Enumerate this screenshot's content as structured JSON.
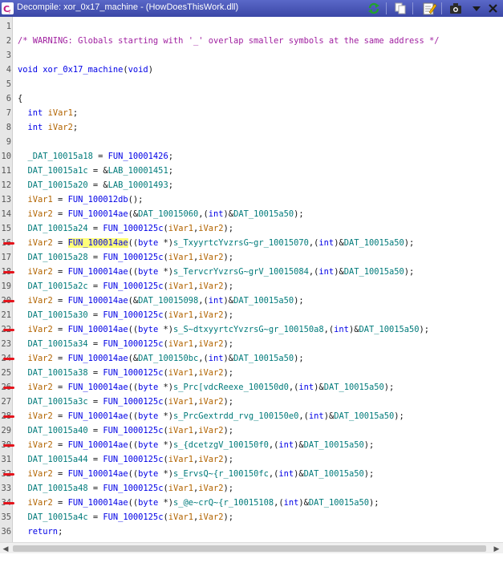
{
  "window": {
    "title": "Decompile: xor_0x17_machine - (HowDoesThisWork.dll)",
    "toolbar": [
      "refresh-icon",
      "copy-icon",
      "edit-icon",
      "snapshot-icon",
      "menu-dropdown-icon",
      "close-icon"
    ]
  },
  "colors": {
    "titlebar": "#4652b6",
    "annotation": "#e4141c",
    "highlight": "#ffff7a"
  },
  "lines": [
    {
      "n": "1",
      "tokens": []
    },
    {
      "n": "2",
      "tokens": [
        {
          "t": "/* WARNING: Globals starting with '_' overlap smaller symbols at the same address */",
          "c": "comment"
        }
      ]
    },
    {
      "n": "3",
      "tokens": []
    },
    {
      "n": "4",
      "tokens": [
        {
          "t": "void",
          "c": "type"
        },
        {
          "t": " "
        },
        {
          "t": "xor_0x17_machine",
          "c": "func"
        },
        {
          "t": "("
        },
        {
          "t": "void",
          "c": "type"
        },
        {
          "t": ")"
        }
      ]
    },
    {
      "n": "5",
      "tokens": []
    },
    {
      "n": "6",
      "tokens": [
        {
          "t": "{"
        }
      ]
    },
    {
      "n": "7",
      "tokens": [
        {
          "t": "  "
        },
        {
          "t": "int",
          "c": "type"
        },
        {
          "t": " "
        },
        {
          "t": "iVar1",
          "c": "local"
        },
        {
          "t": ";"
        }
      ]
    },
    {
      "n": "8",
      "tokens": [
        {
          "t": "  "
        },
        {
          "t": "int",
          "c": "type"
        },
        {
          "t": " "
        },
        {
          "t": "iVar2",
          "c": "local"
        },
        {
          "t": ";"
        }
      ]
    },
    {
      "n": "9",
      "tokens": []
    },
    {
      "n": "10",
      "tokens": [
        {
          "t": "  "
        },
        {
          "t": "_DAT_10015a18",
          "c": "global"
        },
        {
          "t": " = "
        },
        {
          "t": "FUN_10001426",
          "c": "func"
        },
        {
          "t": ";"
        }
      ]
    },
    {
      "n": "11",
      "tokens": [
        {
          "t": "  "
        },
        {
          "t": "DAT_10015a1c",
          "c": "global"
        },
        {
          "t": " = &"
        },
        {
          "t": "LAB_10001451",
          "c": "global"
        },
        {
          "t": ";"
        }
      ]
    },
    {
      "n": "12",
      "tokens": [
        {
          "t": "  "
        },
        {
          "t": "DAT_10015a20",
          "c": "global"
        },
        {
          "t": " = &"
        },
        {
          "t": "LAB_10001493",
          "c": "global"
        },
        {
          "t": ";"
        }
      ]
    },
    {
      "n": "13",
      "tokens": [
        {
          "t": "  "
        },
        {
          "t": "iVar1",
          "c": "local"
        },
        {
          "t": " = "
        },
        {
          "t": "FUN_100012db",
          "c": "func"
        },
        {
          "t": "();"
        }
      ]
    },
    {
      "n": "14",
      "tokens": [
        {
          "t": "  "
        },
        {
          "t": "iVar2",
          "c": "local"
        },
        {
          "t": " = "
        },
        {
          "t": "FUN_100014ae",
          "c": "func"
        },
        {
          "t": "(&"
        },
        {
          "t": "DAT_10015060",
          "c": "global"
        },
        {
          "t": ",("
        },
        {
          "t": "int",
          "c": "type"
        },
        {
          "t": ")&"
        },
        {
          "t": "DAT_10015a50",
          "c": "global"
        },
        {
          "t": ");"
        }
      ]
    },
    {
      "n": "15",
      "tokens": [
        {
          "t": "  "
        },
        {
          "t": "DAT_10015a24",
          "c": "global"
        },
        {
          "t": " = "
        },
        {
          "t": "FUN_1000125c",
          "c": "func"
        },
        {
          "t": "("
        },
        {
          "t": "iVar1",
          "c": "local"
        },
        {
          "t": ","
        },
        {
          "t": "iVar2",
          "c": "local"
        },
        {
          "t": ");"
        }
      ]
    },
    {
      "n": "16",
      "mark": true,
      "tokens": [
        {
          "t": "  "
        },
        {
          "t": "iVar2",
          "c": "local"
        },
        {
          "t": " = "
        },
        {
          "t": "FUN_100014ae",
          "c": "func hl"
        },
        {
          "t": "(("
        },
        {
          "t": "byte",
          "c": "type"
        },
        {
          "t": " *)"
        },
        {
          "t": "s_TxyyrtcYvzrsG~gr_10015070",
          "c": "str"
        },
        {
          "t": ",("
        },
        {
          "t": "int",
          "c": "type"
        },
        {
          "t": ")&"
        },
        {
          "t": "DAT_10015a50",
          "c": "global"
        },
        {
          "t": ");"
        }
      ]
    },
    {
      "n": "17",
      "tokens": [
        {
          "t": "  "
        },
        {
          "t": "DAT_10015a28",
          "c": "global"
        },
        {
          "t": " = "
        },
        {
          "t": "FUN_1000125c",
          "c": "func"
        },
        {
          "t": "("
        },
        {
          "t": "iVar1",
          "c": "local"
        },
        {
          "t": ","
        },
        {
          "t": "iVar2",
          "c": "local"
        },
        {
          "t": ");"
        }
      ]
    },
    {
      "n": "18",
      "mark": true,
      "tokens": [
        {
          "t": "  "
        },
        {
          "t": "iVar2",
          "c": "local"
        },
        {
          "t": " = "
        },
        {
          "t": "FUN_100014ae",
          "c": "func"
        },
        {
          "t": "(("
        },
        {
          "t": "byte",
          "c": "type"
        },
        {
          "t": " *)"
        },
        {
          "t": "s_TervcrYvzrsG~grV_10015084",
          "c": "str"
        },
        {
          "t": ",("
        },
        {
          "t": "int",
          "c": "type"
        },
        {
          "t": ")&"
        },
        {
          "t": "DAT_10015a50",
          "c": "global"
        },
        {
          "t": ");"
        }
      ]
    },
    {
      "n": "19",
      "tokens": [
        {
          "t": "  "
        },
        {
          "t": "DAT_10015a2c",
          "c": "global"
        },
        {
          "t": " = "
        },
        {
          "t": "FUN_1000125c",
          "c": "func"
        },
        {
          "t": "("
        },
        {
          "t": "iVar1",
          "c": "local"
        },
        {
          "t": ","
        },
        {
          "t": "iVar2",
          "c": "local"
        },
        {
          "t": ");"
        }
      ]
    },
    {
      "n": "20",
      "mark": true,
      "tokens": [
        {
          "t": "  "
        },
        {
          "t": "iVar2",
          "c": "local"
        },
        {
          "t": " = "
        },
        {
          "t": "FUN_100014ae",
          "c": "func"
        },
        {
          "t": "(&"
        },
        {
          "t": "DAT_10015098",
          "c": "global"
        },
        {
          "t": ",("
        },
        {
          "t": "int",
          "c": "type"
        },
        {
          "t": ")&"
        },
        {
          "t": "DAT_10015a50",
          "c": "global"
        },
        {
          "t": ");"
        }
      ]
    },
    {
      "n": "21",
      "tokens": [
        {
          "t": "  "
        },
        {
          "t": "DAT_10015a30",
          "c": "global"
        },
        {
          "t": " = "
        },
        {
          "t": "FUN_1000125c",
          "c": "func"
        },
        {
          "t": "("
        },
        {
          "t": "iVar1",
          "c": "local"
        },
        {
          "t": ","
        },
        {
          "t": "iVar2",
          "c": "local"
        },
        {
          "t": ");"
        }
      ]
    },
    {
      "n": "22",
      "mark": true,
      "tokens": [
        {
          "t": "  "
        },
        {
          "t": "iVar2",
          "c": "local"
        },
        {
          "t": " = "
        },
        {
          "t": "FUN_100014ae",
          "c": "func"
        },
        {
          "t": "(("
        },
        {
          "t": "byte",
          "c": "type"
        },
        {
          "t": " *)"
        },
        {
          "t": "s_S~dtxyyrtcYvzrsG~gr_100150a8",
          "c": "str"
        },
        {
          "t": ",("
        },
        {
          "t": "int",
          "c": "type"
        },
        {
          "t": ")&"
        },
        {
          "t": "DAT_10015a50",
          "c": "global"
        },
        {
          "t": ");"
        }
      ]
    },
    {
      "n": "23",
      "tokens": [
        {
          "t": "  "
        },
        {
          "t": "DAT_10015a34",
          "c": "global"
        },
        {
          "t": " = "
        },
        {
          "t": "FUN_1000125c",
          "c": "func"
        },
        {
          "t": "("
        },
        {
          "t": "iVar1",
          "c": "local"
        },
        {
          "t": ","
        },
        {
          "t": "iVar2",
          "c": "local"
        },
        {
          "t": ");"
        }
      ]
    },
    {
      "n": "24",
      "mark": true,
      "tokens": [
        {
          "t": "  "
        },
        {
          "t": "iVar2",
          "c": "local"
        },
        {
          "t": " = "
        },
        {
          "t": "FUN_100014ae",
          "c": "func"
        },
        {
          "t": "(&"
        },
        {
          "t": "DAT_100150bc",
          "c": "global"
        },
        {
          "t": ",("
        },
        {
          "t": "int",
          "c": "type"
        },
        {
          "t": ")&"
        },
        {
          "t": "DAT_10015a50",
          "c": "global"
        },
        {
          "t": ");"
        }
      ]
    },
    {
      "n": "25",
      "tokens": [
        {
          "t": "  "
        },
        {
          "t": "DAT_10015a38",
          "c": "global"
        },
        {
          "t": " = "
        },
        {
          "t": "FUN_1000125c",
          "c": "func"
        },
        {
          "t": "("
        },
        {
          "t": "iVar1",
          "c": "local"
        },
        {
          "t": ","
        },
        {
          "t": "iVar2",
          "c": "local"
        },
        {
          "t": ");"
        }
      ]
    },
    {
      "n": "26",
      "mark": true,
      "tokens": [
        {
          "t": "  "
        },
        {
          "t": "iVar2",
          "c": "local"
        },
        {
          "t": " = "
        },
        {
          "t": "FUN_100014ae",
          "c": "func"
        },
        {
          "t": "(("
        },
        {
          "t": "byte",
          "c": "type"
        },
        {
          "t": " *)"
        },
        {
          "t": "s_Prc[vdcReexe_100150d0",
          "c": "str"
        },
        {
          "t": ",("
        },
        {
          "t": "int",
          "c": "type"
        },
        {
          "t": ")&"
        },
        {
          "t": "DAT_10015a50",
          "c": "global"
        },
        {
          "t": ");"
        }
      ]
    },
    {
      "n": "27",
      "tokens": [
        {
          "t": "  "
        },
        {
          "t": "DAT_10015a3c",
          "c": "global"
        },
        {
          "t": " = "
        },
        {
          "t": "FUN_1000125c",
          "c": "func"
        },
        {
          "t": "("
        },
        {
          "t": "iVar1",
          "c": "local"
        },
        {
          "t": ","
        },
        {
          "t": "iVar2",
          "c": "local"
        },
        {
          "t": ");"
        }
      ]
    },
    {
      "n": "28",
      "mark": true,
      "tokens": [
        {
          "t": "  "
        },
        {
          "t": "iVar2",
          "c": "local"
        },
        {
          "t": " = "
        },
        {
          "t": "FUN_100014ae",
          "c": "func"
        },
        {
          "t": "(("
        },
        {
          "t": "byte",
          "c": "type"
        },
        {
          "t": " *)"
        },
        {
          "t": "s_PrcGextrdd_rvg_100150e0",
          "c": "str"
        },
        {
          "t": ",("
        },
        {
          "t": "int",
          "c": "type"
        },
        {
          "t": ")&"
        },
        {
          "t": "DAT_10015a50",
          "c": "global"
        },
        {
          "t": ");"
        }
      ]
    },
    {
      "n": "29",
      "tokens": [
        {
          "t": "  "
        },
        {
          "t": "DAT_10015a40",
          "c": "global"
        },
        {
          "t": " = "
        },
        {
          "t": "FUN_1000125c",
          "c": "func"
        },
        {
          "t": "("
        },
        {
          "t": "iVar1",
          "c": "local"
        },
        {
          "t": ","
        },
        {
          "t": "iVar2",
          "c": "local"
        },
        {
          "t": ");"
        }
      ]
    },
    {
      "n": "30",
      "mark": true,
      "tokens": [
        {
          "t": "  "
        },
        {
          "t": "iVar2",
          "c": "local"
        },
        {
          "t": " = "
        },
        {
          "t": "FUN_100014ae",
          "c": "func"
        },
        {
          "t": "(("
        },
        {
          "t": "byte",
          "c": "type"
        },
        {
          "t": " *)"
        },
        {
          "t": "s_{dcetzgV_100150f0",
          "c": "str"
        },
        {
          "t": ",("
        },
        {
          "t": "int",
          "c": "type"
        },
        {
          "t": ")&"
        },
        {
          "t": "DAT_10015a50",
          "c": "global"
        },
        {
          "t": ");"
        }
      ]
    },
    {
      "n": "31",
      "tokens": [
        {
          "t": "  "
        },
        {
          "t": "DAT_10015a44",
          "c": "global"
        },
        {
          "t": " = "
        },
        {
          "t": "FUN_1000125c",
          "c": "func"
        },
        {
          "t": "("
        },
        {
          "t": "iVar1",
          "c": "local"
        },
        {
          "t": ","
        },
        {
          "t": "iVar2",
          "c": "local"
        },
        {
          "t": ");"
        }
      ]
    },
    {
      "n": "32",
      "mark": true,
      "tokens": [
        {
          "t": "  "
        },
        {
          "t": "iVar2",
          "c": "local"
        },
        {
          "t": " = "
        },
        {
          "t": "FUN_100014ae",
          "c": "func"
        },
        {
          "t": "(("
        },
        {
          "t": "byte",
          "c": "type"
        },
        {
          "t": " *)"
        },
        {
          "t": "s_ErvsQ~{r_100150fc",
          "c": "str"
        },
        {
          "t": ",("
        },
        {
          "t": "int",
          "c": "type"
        },
        {
          "t": ")&"
        },
        {
          "t": "DAT_10015a50",
          "c": "global"
        },
        {
          "t": ");"
        }
      ]
    },
    {
      "n": "33",
      "tokens": [
        {
          "t": "  "
        },
        {
          "t": "DAT_10015a48",
          "c": "global"
        },
        {
          "t": " = "
        },
        {
          "t": "FUN_1000125c",
          "c": "func"
        },
        {
          "t": "("
        },
        {
          "t": "iVar1",
          "c": "local"
        },
        {
          "t": ","
        },
        {
          "t": "iVar2",
          "c": "local"
        },
        {
          "t": ");"
        }
      ]
    },
    {
      "n": "34",
      "mark": true,
      "tokens": [
        {
          "t": "  "
        },
        {
          "t": "iVar2",
          "c": "local"
        },
        {
          "t": " = "
        },
        {
          "t": "FUN_100014ae",
          "c": "func"
        },
        {
          "t": "(("
        },
        {
          "t": "byte",
          "c": "type"
        },
        {
          "t": " *)"
        },
        {
          "t": "s_@e~crQ~{r_10015108",
          "c": "str"
        },
        {
          "t": ",("
        },
        {
          "t": "int",
          "c": "type"
        },
        {
          "t": ")&"
        },
        {
          "t": "DAT_10015a50",
          "c": "global"
        },
        {
          "t": ");"
        }
      ]
    },
    {
      "n": "35",
      "tokens": [
        {
          "t": "  "
        },
        {
          "t": "DAT_10015a4c",
          "c": "global"
        },
        {
          "t": " = "
        },
        {
          "t": "FUN_1000125c",
          "c": "func"
        },
        {
          "t": "("
        },
        {
          "t": "iVar1",
          "c": "local"
        },
        {
          "t": ","
        },
        {
          "t": "iVar2",
          "c": "local"
        },
        {
          "t": ");"
        }
      ]
    },
    {
      "n": "36",
      "tokens": [
        {
          "t": "  "
        },
        {
          "t": "return",
          "c": "keyword"
        },
        {
          "t": ";"
        }
      ]
    }
  ]
}
